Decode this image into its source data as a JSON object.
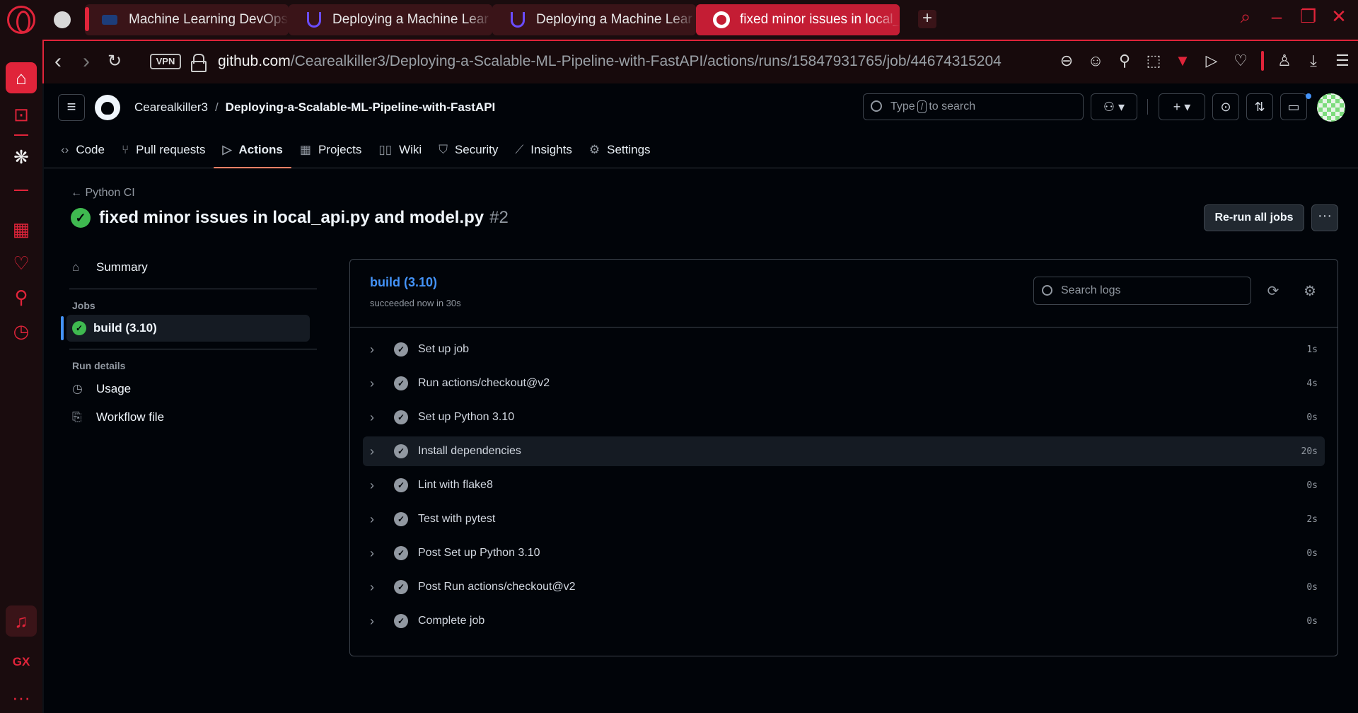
{
  "browser": {
    "tabs": [
      {
        "title": "Machine Learning DevOps",
        "icon": "devops-icon"
      },
      {
        "title": "Deploying a Machine Lear",
        "icon": "udacity-icon"
      },
      {
        "title": "Deploying a Machine Lear",
        "icon": "udacity-icon"
      },
      {
        "title": "fixed minor issues in local_",
        "icon": "github-icon",
        "active": true
      }
    ],
    "new_tab": "+",
    "vpn_label": "VPN",
    "url_host": "github.com",
    "url_path": "/Cearealkiller3/Deploying-a-Scalable-ML-Pipeline-with-FastAPI/actions/runs/15847931765/job/44674315204",
    "accent": "#e0243a"
  },
  "sidebar_brand": {
    "gx_label": "GX",
    "more": "···"
  },
  "header": {
    "owner": "Cearealkiller3",
    "repo": "Deploying-a-Scalable-ML-Pipeline-with-FastAPI",
    "search_prefix": "Type",
    "search_kbd": "/",
    "search_suffix": "to search"
  },
  "repo_nav": {
    "code": "Code",
    "pulls": "Pull requests",
    "actions": "Actions",
    "projects": "Projects",
    "wiki": "Wiki",
    "security": "Security",
    "insights": "Insights",
    "settings": "Settings"
  },
  "run": {
    "workflow": "Python CI",
    "title": "fixed minor issues in local_api.py and model.py",
    "number": "#2",
    "rerun_label": "Re-run all jobs",
    "status_color": "#3fb950"
  },
  "side_nav": {
    "summary": "Summary",
    "jobs_label": "Jobs",
    "job": "build (3.10)",
    "run_details_label": "Run details",
    "usage": "Usage",
    "workflow_file": "Workflow file"
  },
  "job": {
    "name": "build (3.10)",
    "status": "succeeded now in 30s",
    "search_placeholder": "Search logs",
    "steps": [
      {
        "name": "Set up job",
        "duration": "1s"
      },
      {
        "name": "Run actions/checkout@v2",
        "duration": "4s"
      },
      {
        "name": "Set up Python 3.10",
        "duration": "0s"
      },
      {
        "name": "Install dependencies",
        "duration": "20s"
      },
      {
        "name": "Lint with flake8",
        "duration": "0s"
      },
      {
        "name": "Test with pytest",
        "duration": "2s"
      },
      {
        "name": "Post Set up Python 3.10",
        "duration": "0s"
      },
      {
        "name": "Post Run actions/checkout@v2",
        "duration": "0s"
      },
      {
        "name": "Complete job",
        "duration": "0s"
      }
    ]
  }
}
